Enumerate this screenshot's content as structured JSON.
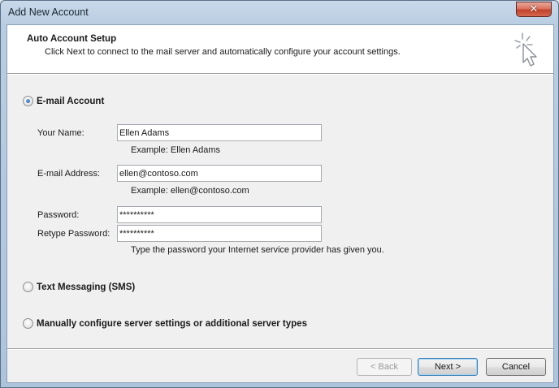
{
  "window": {
    "title": "Add New Account",
    "close_glyph": "✕"
  },
  "header": {
    "title": "Auto Account Setup",
    "description": "Click Next to connect to the mail server and automatically configure your account settings.",
    "icon": "wizard-cursor-icon"
  },
  "options": {
    "email_account": {
      "label": "E-mail Account",
      "selected": true
    },
    "text_messaging": {
      "label": "Text Messaging (SMS)",
      "selected": false
    },
    "manual": {
      "label": "Manually configure server settings or additional server types",
      "selected": false
    }
  },
  "form": {
    "name": {
      "label": "Your Name:",
      "value": "Ellen Adams",
      "hint": "Example: Ellen Adams"
    },
    "email": {
      "label": "E-mail Address:",
      "value": "ellen@contoso.com",
      "hint": "Example: ellen@contoso.com"
    },
    "password": {
      "label": "Password:",
      "value": "**********"
    },
    "retype_password": {
      "label": "Retype Password:",
      "value": "**********"
    },
    "password_hint": "Type the password your Internet service provider has given you."
  },
  "buttons": {
    "back": "< Back",
    "next": "Next >",
    "cancel": "Cancel"
  },
  "colors": {
    "client_bg": "#f0f0f0",
    "header_bg": "#ffffff",
    "close_red": "#c4422b",
    "default_button_border": "#3c7fb1"
  }
}
